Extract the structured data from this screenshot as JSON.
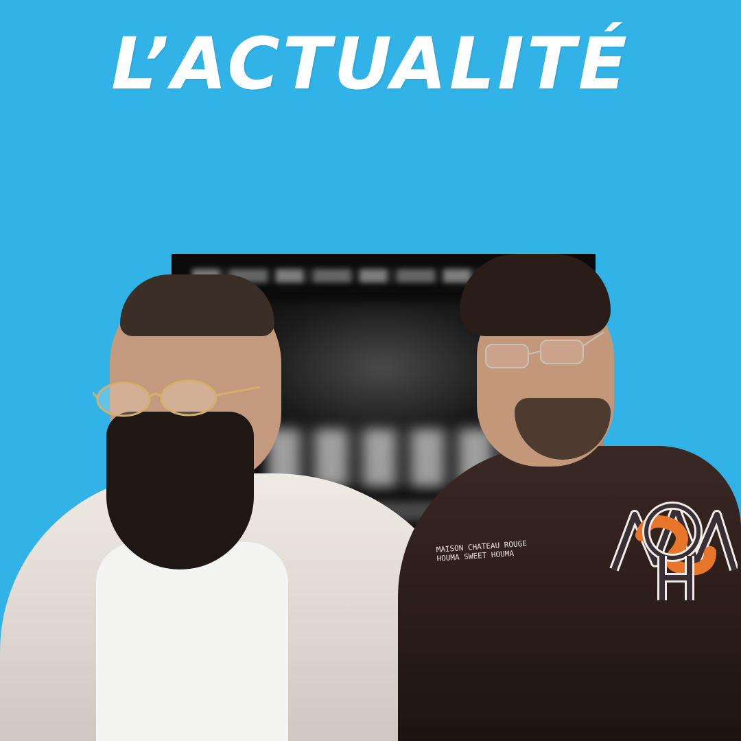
{
  "header": {
    "title": "L’ACTUALITÉ"
  },
  "jacket_embroidery": {
    "line1": "MAISON CHATEAU ROUGE",
    "line2": "HOUMA SWEET HOUMA"
  },
  "colors": {
    "background": "#31b3e8",
    "title": "#ffffff",
    "emblem_accent": "#e8762a"
  },
  "icons": {
    "emblem": "monogram-crest-icon"
  }
}
